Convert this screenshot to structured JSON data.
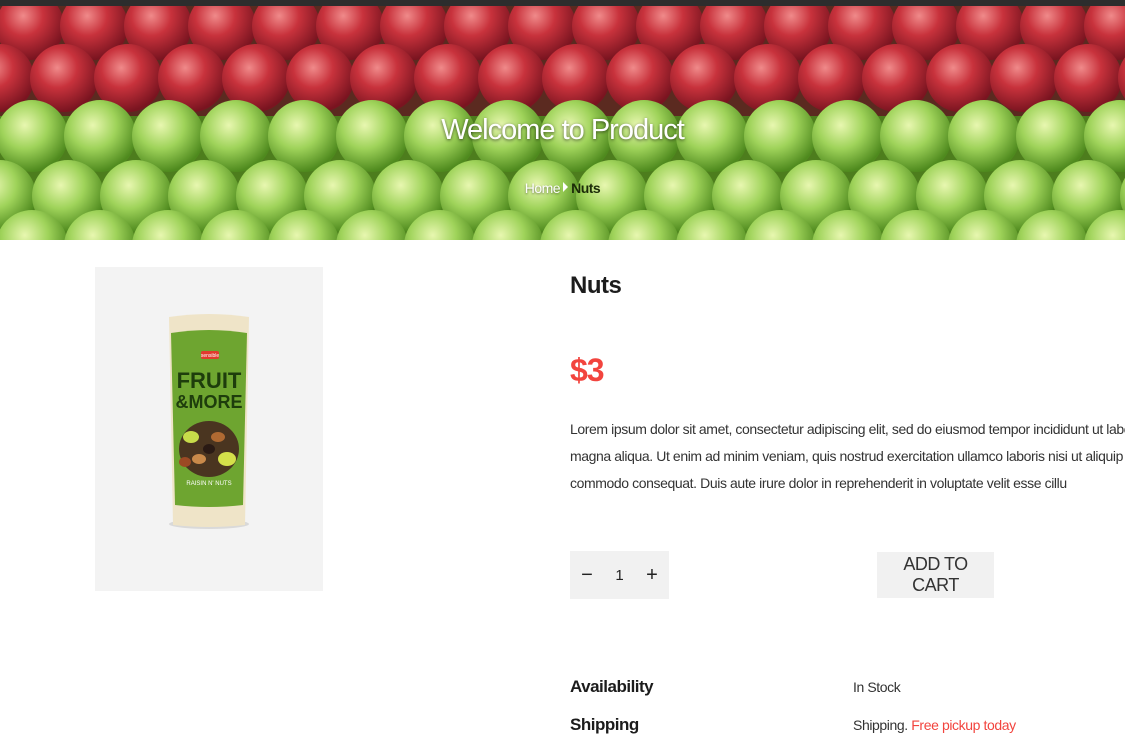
{
  "hero": {
    "title": "Welcome to Product",
    "breadcrumb": {
      "home": "Home",
      "current": "Nuts"
    }
  },
  "product": {
    "name": "Nuts",
    "price": "$3",
    "description_lines": [
      "Lorem ipsum dolor sit amet, consectetur adipiscing elit, sed do eiusmod tempor incididunt ut labore et dolo",
      "magna aliqua. Ut enim ad minim veniam, quis nostrud exercitation ullamco laboris nisi ut aliquip ex ea",
      "commodo consequat. Duis aute irure dolor in reprehenderit in voluptate velit esse cillu"
    ],
    "image_label": {
      "brand": "sensible",
      "line1": "FRUIT",
      "line2": "&MORE",
      "flavor": "RAISIN N' NUTS"
    },
    "quantity": "1",
    "quantity_minus": "−",
    "quantity_plus": "+",
    "add_to_cart": "ADD TO CART"
  },
  "info": {
    "availability_label": "Availability",
    "availability_value": "In Stock",
    "shipping_label": "Shipping",
    "shipping_value": "Shipping.",
    "shipping_highlight": "Free pickup today"
  },
  "colors": {
    "accent": "#f2443e",
    "panel": "#f1f1f1"
  },
  "icons": {
    "decrement": "minus-icon",
    "increment": "plus-icon",
    "breadcrumb_separator": "caret-right-icon"
  }
}
